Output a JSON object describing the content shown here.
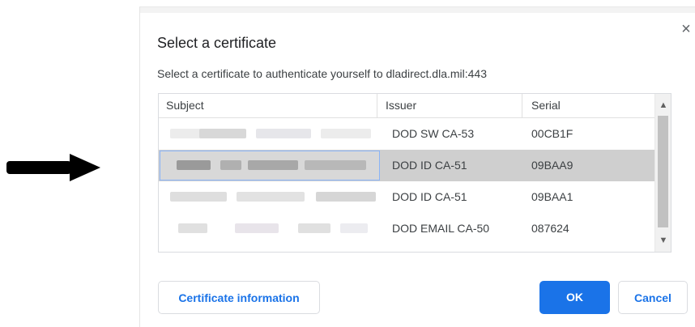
{
  "dialog": {
    "title": "Select a certificate",
    "subtitle": "Select a certificate to authenticate yourself to dladirect.dla.mil:443",
    "close_icon": "close-icon"
  },
  "table": {
    "columns": [
      "Subject",
      "Issuer",
      "Serial"
    ],
    "rows": [
      {
        "issuer": "DOD SW CA-53",
        "serial": "00CB1F",
        "selected": false
      },
      {
        "issuer": "DOD ID CA-51",
        "serial": "09BAA9",
        "selected": true
      },
      {
        "issuer": "DOD ID CA-51",
        "serial": "09BAA1",
        "selected": false
      },
      {
        "issuer": "DOD EMAIL CA-50",
        "serial": "087624",
        "selected": false
      }
    ]
  },
  "buttons": {
    "info": "Certificate information",
    "ok": "OK",
    "cancel": "Cancel"
  },
  "colors": {
    "accent": "#1a73e8",
    "selected_row": "#cfcfcf"
  },
  "annotation": {
    "arrow_icon": "arrow-right-icon"
  }
}
